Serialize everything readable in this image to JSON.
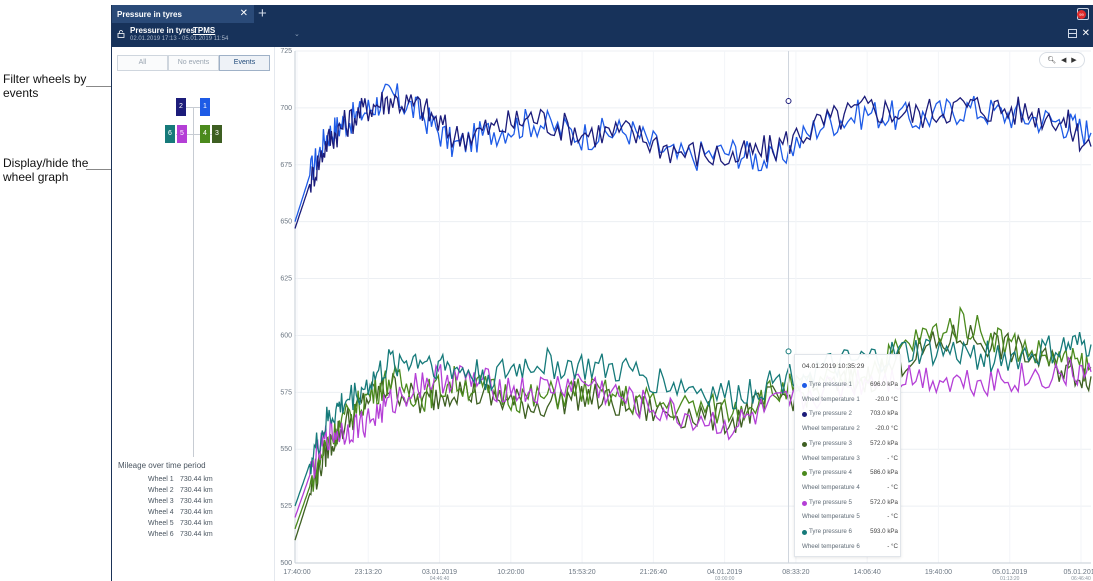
{
  "annotations": {
    "filter": [
      "Filter wheels by",
      "events"
    ],
    "display": [
      "Display/hide the",
      "wheel graph"
    ]
  },
  "tab": {
    "title": "Pressure in tyres"
  },
  "notifications": {
    "badge": "99"
  },
  "header": {
    "title": "Pressure in tyres",
    "link": "TPMS",
    "period": "02.01.2019 17:13 - 05.01.2019 11:54"
  },
  "filters": [
    {
      "label": "All",
      "active": false
    },
    {
      "label": "No events",
      "active": false
    },
    {
      "label": "Events",
      "active": true
    }
  ],
  "wheels": [
    {
      "label": "2",
      "color": "#1c1c7a"
    },
    {
      "label": "1",
      "color": "#1e5be6"
    },
    {
      "label": "6",
      "color": "#167a7a"
    },
    {
      "label": "5",
      "color": "#b43fd6"
    },
    {
      "label": "4",
      "color": "#4b8a1d"
    },
    {
      "label": "3",
      "color": "#3e5f22"
    }
  ],
  "mileage": {
    "title": "Mileage over time period",
    "rows": [
      {
        "wheel": "Wheel 1",
        "value": "730.44 km"
      },
      {
        "wheel": "Wheel 2",
        "value": "730.44 km"
      },
      {
        "wheel": "Wheel 3",
        "value": "730.44 km"
      },
      {
        "wheel": "Wheel 4",
        "value": "730.44 km"
      },
      {
        "wheel": "Wheel 5",
        "value": "730.44 km"
      },
      {
        "wheel": "Wheel 6",
        "value": "730.44 km"
      }
    ]
  },
  "tooltip": {
    "time": "04.01.2019 10:35:29",
    "rows": [
      {
        "label": "Tyre pressure 1",
        "value": "696.0 kPa",
        "color": "#1e5be6"
      },
      {
        "label": "Wheel temperature 1",
        "value": "-20.0 °C",
        "color": ""
      },
      {
        "label": "Tyre pressure 2",
        "value": "703.0 kPa",
        "color": "#1c1c7a"
      },
      {
        "label": "Wheel temperature 2",
        "value": "-20.0 °C",
        "color": ""
      },
      {
        "label": "Tyre pressure 3",
        "value": "572.0 kPa",
        "color": "#3e5f22"
      },
      {
        "label": "Wheel temperature 3",
        "value": "- °C",
        "color": ""
      },
      {
        "label": "Tyre pressure 4",
        "value": "586.0 kPa",
        "color": "#4b8a1d"
      },
      {
        "label": "Wheel temperature 4",
        "value": "- °C",
        "color": ""
      },
      {
        "label": "Tyre pressure 5",
        "value": "572.0 kPa",
        "color": "#b43fd6"
      },
      {
        "label": "Wheel temperature 5",
        "value": "- °C",
        "color": ""
      },
      {
        "label": "Tyre pressure 6",
        "value": "593.0 kPa",
        "color": "#167a7a"
      },
      {
        "label": "Wheel temperature 6",
        "value": "- °C",
        "color": ""
      }
    ]
  },
  "chart_data": {
    "type": "line",
    "ylim": [
      500,
      725
    ],
    "y_ticks": [
      "500",
      "525",
      "550",
      "575",
      "600",
      "625",
      "650",
      "675",
      "700",
      "725"
    ],
    "x_ticks": [
      {
        "main": "17:40:00",
        "sub": ""
      },
      {
        "main": "23:13:20",
        "sub": ""
      },
      {
        "main": "03.01.2019",
        "sub": "04:46:40"
      },
      {
        "main": "10:20:00",
        "sub": ""
      },
      {
        "main": "15:53:20",
        "sub": ""
      },
      {
        "main": "21:26:40",
        "sub": ""
      },
      {
        "main": "04.01.2019",
        "sub": "03:00:00"
      },
      {
        "main": "08:33:20",
        "sub": ""
      },
      {
        "main": "14:06:40",
        "sub": ""
      },
      {
        "main": "19:40:00",
        "sub": ""
      },
      {
        "main": "05.01.2019",
        "sub": "01:13:20"
      },
      {
        "main": "05.01.2019",
        "sub": "06:46:40"
      }
    ],
    "series": [
      {
        "name": "Tyre pressure 1",
        "color": "#1e5be6",
        "x": [
          0,
          2,
          4,
          6,
          9,
          12,
          16,
          20,
          25,
          30,
          36,
          42,
          48,
          55,
          60,
          66,
          72,
          78,
          84,
          90,
          96,
          100
        ],
        "values": [
          650,
          672,
          688,
          693,
          699,
          706,
          697,
          683,
          690,
          694,
          688,
          690,
          678,
          681,
          676,
          693,
          698,
          695,
          700,
          697,
          694,
          689
        ]
      },
      {
        "name": "Tyre pressure 2",
        "color": "#1c1c7a",
        "x": [
          0,
          2,
          4,
          6,
          9,
          12,
          16,
          20,
          25,
          30,
          36,
          42,
          48,
          55,
          60,
          66,
          72,
          78,
          84,
          90,
          96,
          100
        ],
        "values": [
          647,
          668,
          685,
          692,
          700,
          704,
          700,
          687,
          691,
          696,
          689,
          689,
          681,
          678,
          682,
          693,
          700,
          697,
          701,
          699,
          696,
          683
        ]
      },
      {
        "name": "Tyre pressure 3",
        "color": "#3e5f22",
        "x": [
          0,
          2,
          4,
          6,
          9,
          12,
          16,
          20,
          25,
          30,
          36,
          42,
          48,
          55,
          60,
          66,
          72,
          78,
          84,
          90,
          96,
          100
        ],
        "values": [
          510,
          532,
          550,
          560,
          572,
          578,
          570,
          577,
          572,
          569,
          574,
          568,
          566,
          563,
          572,
          576,
          581,
          592,
          600,
          594,
          586,
          582
        ]
      },
      {
        "name": "Tyre pressure 4",
        "color": "#4b8a1d",
        "x": [
          0,
          2,
          4,
          6,
          9,
          12,
          16,
          20,
          25,
          30,
          36,
          42,
          48,
          55,
          60,
          66,
          72,
          78,
          84,
          90,
          96,
          100
        ],
        "values": [
          515,
          535,
          553,
          562,
          573,
          581,
          573,
          580,
          575,
          572,
          576,
          572,
          569,
          567,
          575,
          579,
          585,
          598,
          606,
          596,
          589,
          586
        ]
      },
      {
        "name": "Tyre pressure 5",
        "color": "#b43fd6",
        "x": [
          0,
          2,
          4,
          6,
          9,
          12,
          16,
          20,
          25,
          30,
          36,
          42,
          48,
          55,
          60,
          66,
          72,
          78,
          84,
          90,
          96,
          100
        ],
        "values": [
          520,
          540,
          556,
          558,
          562,
          570,
          580,
          582,
          578,
          575,
          580,
          571,
          565,
          560,
          568,
          575,
          581,
          582,
          580,
          581,
          583,
          584
        ]
      },
      {
        "name": "Tyre pressure 6",
        "color": "#167a7a",
        "x": [
          0,
          2,
          4,
          6,
          9,
          12,
          16,
          20,
          25,
          30,
          36,
          42,
          48,
          55,
          60,
          66,
          72,
          78,
          84,
          90,
          96,
          100
        ],
        "values": [
          525,
          545,
          562,
          570,
          578,
          588,
          590,
          585,
          582,
          588,
          586,
          584,
          578,
          573,
          580,
          585,
          589,
          593,
          592,
          590,
          594,
          596
        ]
      }
    ]
  }
}
